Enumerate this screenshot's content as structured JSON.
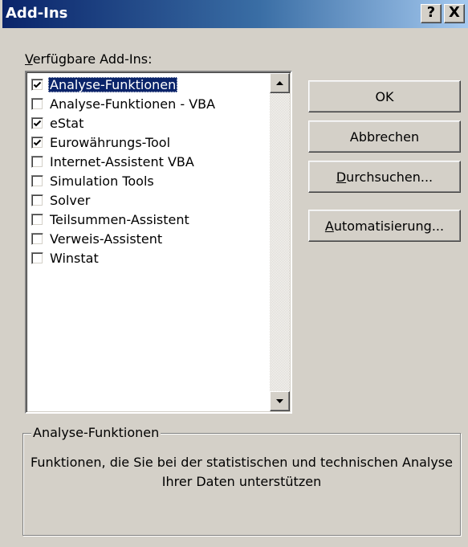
{
  "window": {
    "title": "Add-Ins",
    "help_button": "?",
    "close_button": "X"
  },
  "list": {
    "label_accel": "V",
    "label_rest": "erfügbare Add-Ins:",
    "items": [
      {
        "label": "Analyse-Funktionen",
        "checked": true,
        "selected": true
      },
      {
        "label": "Analyse-Funktionen - VBA",
        "checked": false,
        "selected": false
      },
      {
        "label": "eStat",
        "checked": true,
        "selected": false
      },
      {
        "label": "Eurowährungs-Tool",
        "checked": true,
        "selected": false
      },
      {
        "label": "Internet-Assistent VBA",
        "checked": false,
        "selected": false
      },
      {
        "label": "Simulation Tools",
        "checked": false,
        "selected": false
      },
      {
        "label": "Solver",
        "checked": false,
        "selected": false
      },
      {
        "label": "Teilsummen-Assistent",
        "checked": false,
        "selected": false
      },
      {
        "label": "Verweis-Assistent",
        "checked": false,
        "selected": false
      },
      {
        "label": "Winstat",
        "checked": false,
        "selected": false
      }
    ]
  },
  "buttons": {
    "ok": "OK",
    "cancel": "Abbrechen",
    "browse_accel": "D",
    "browse_rest": "urchsuchen...",
    "automation_accel": "A",
    "automation_rest": "utomatisierung..."
  },
  "description": {
    "title": "Analyse-Funktionen",
    "text": "Funktionen, die Sie bei der statistischen und technischen Analyse Ihrer Daten unterstützen"
  }
}
